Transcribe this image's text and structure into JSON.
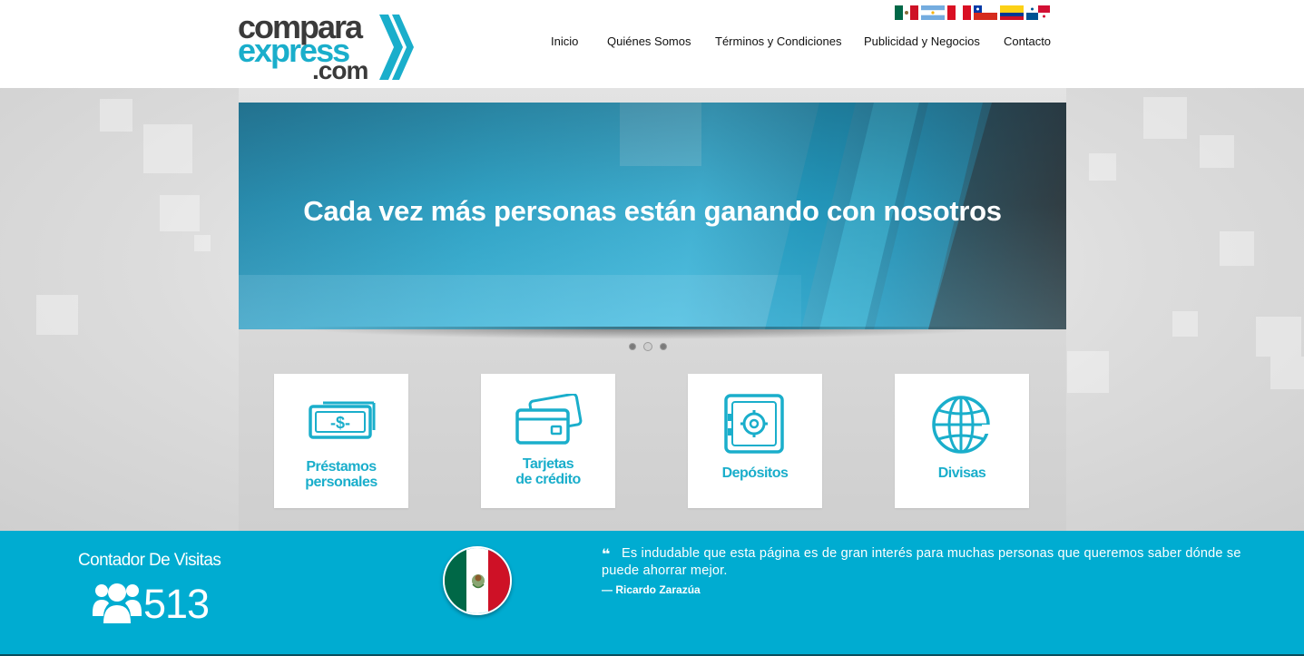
{
  "brand": {
    "line1": "compara",
    "line2": "express",
    "line3": ".com",
    "primary_color": "#1aaecb",
    "dark_color": "#3a3a3a"
  },
  "flags": [
    {
      "name": "mexico-flag-icon"
    },
    {
      "name": "argentina-flag-icon"
    },
    {
      "name": "peru-flag-icon"
    },
    {
      "name": "chile-flag-icon"
    },
    {
      "name": "colombia-flag-icon"
    },
    {
      "name": "panama-flag-icon"
    }
  ],
  "nav": {
    "items": [
      {
        "label": "Inicio"
      },
      {
        "label": "Quiénes Somos"
      },
      {
        "label": "Términos y Condiciones"
      },
      {
        "label": "Publicidad y Negocios"
      },
      {
        "label": "Contacto"
      }
    ]
  },
  "slider": {
    "headline": "Cada vez más personas están ganando con nosotros",
    "slide_count": 3,
    "active_slide": 2
  },
  "services": [
    {
      "label_line1": "Préstamos",
      "label_line2": "personales",
      "icon": "money-bill-icon"
    },
    {
      "label_line1": "Tarjetas",
      "label_line2": "de crédito",
      "icon": "credit-cards-icon"
    },
    {
      "label_line1": "Depósitos",
      "label_line2": "",
      "icon": "safe-icon"
    },
    {
      "label_line1": "Divisas",
      "label_line2": "",
      "icon": "globe-icon"
    }
  ],
  "footer": {
    "counter_title": "Contador De Visitas",
    "counter_value": "513",
    "counter_icon": "users-icon",
    "country_icon": "mexico-flag-icon",
    "quote_text": "Es indudable que esta página es de gran interés para muchas personas que queremos saber dónde se puede ahorrar mejor.",
    "quote_author": "— Ricardo Zarazúa",
    "band_color": "#00acd1"
  }
}
